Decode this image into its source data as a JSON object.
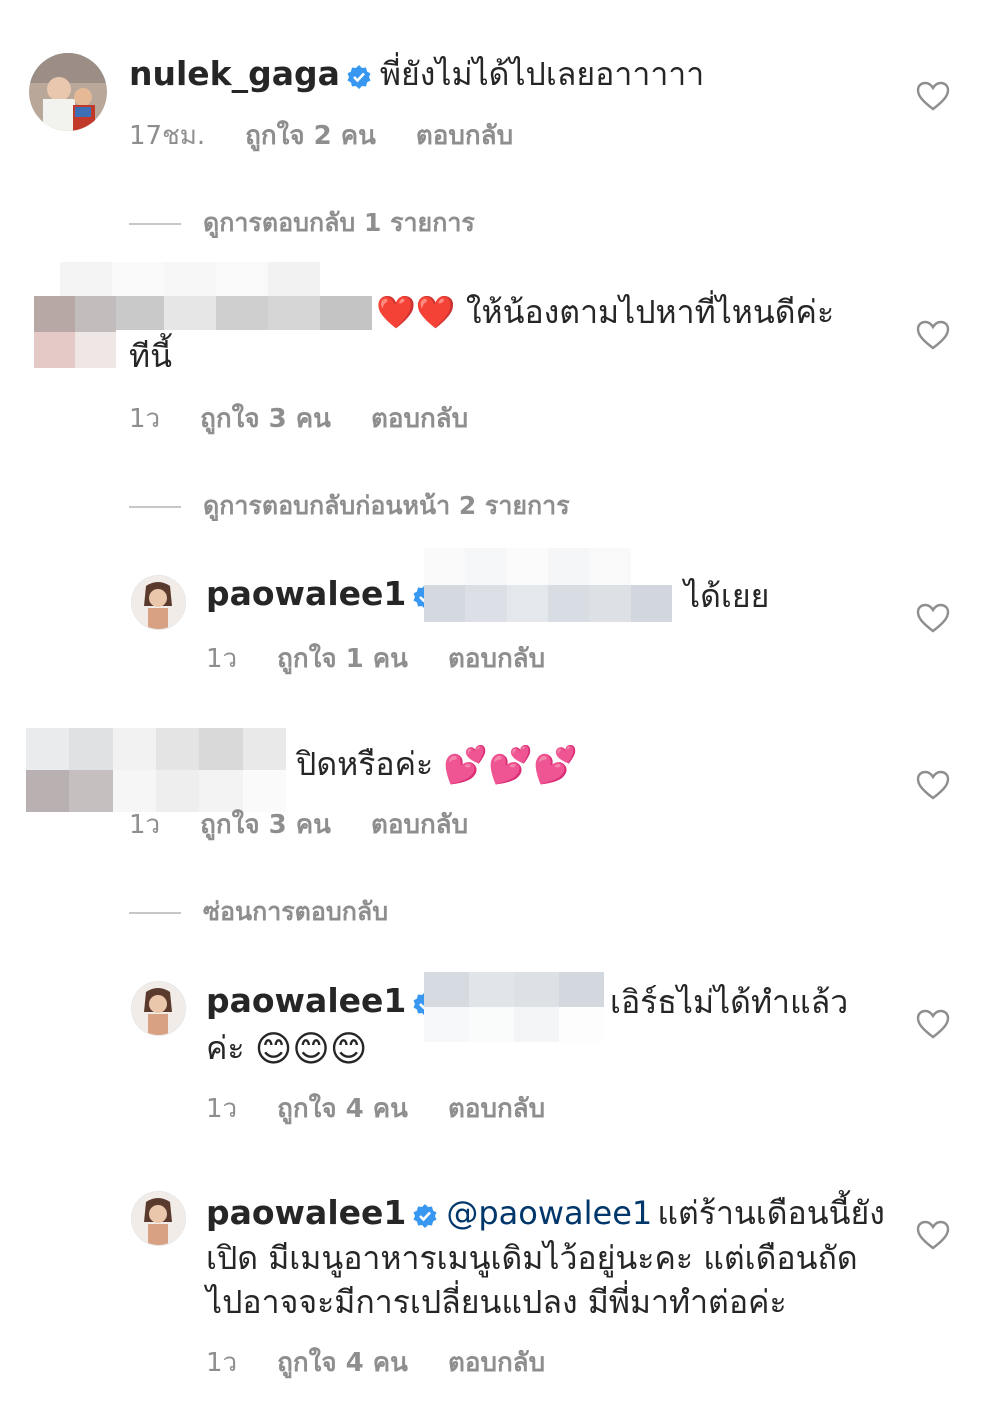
{
  "comments": [
    {
      "username": "nulek_gaga",
      "text": "พี่ยังไม่ได้ไปเลยอาาาาา",
      "time": "17ชม.",
      "likes": "ถูกใจ 2 คน",
      "reply": "ตอบกลับ"
    },
    {
      "text": "❤️❤️ ให้น้องตามไปหาที่ไหนดีค่ะ",
      "text2": "ทีนี้",
      "time": "1ว",
      "likes": "ถูกใจ 3 คน",
      "reply": "ตอบกลับ"
    },
    {
      "username": "paowalee1",
      "text": "ได้เยย",
      "time": "1ว",
      "likes": "ถูกใจ 1 คน",
      "reply": "ตอบกลับ"
    },
    {
      "text": "ปิดหรือค่ะ",
      "emojis": "💕💕💕",
      "time": "1ว",
      "likes": "ถูกใจ 3 คน",
      "reply": "ตอบกลับ"
    },
    {
      "username": "paowalee1",
      "text": "เอิร์ธไม่ได้ทำแล้ว",
      "text2": "ค่ะ",
      "emojis": "😊😊😊",
      "time": "1ว",
      "likes": "ถูกใจ 4 คน",
      "reply": "ตอบกลับ"
    },
    {
      "username": "paowalee1",
      "mention": "@paowalee1",
      "text": "แต่ร้านเดือนนี้ยัง",
      "text2": "เปิด มีเมนูอาหารเมนูเดิมไว้อยู่นะคะ แต่เดือนถัด",
      "text3": "ไปอาจจะมีการเปลี่ยนแปลง มีพี่มาทำต่อค่ะ",
      "time": "1ว",
      "likes": "ถูกใจ 4 คน",
      "reply": "ตอบกลับ"
    }
  ],
  "toggles": {
    "view_replies": "ดูการตอบกลับ 1 รายการ",
    "view_previous": "ดูการตอบกลับก่อนหน้า 2 รายการ",
    "hide_replies": "ซ่อนการตอบกลับ"
  },
  "colors": {
    "text": "#262626",
    "meta": "#8e8e8e",
    "mention": "#00376b",
    "verified": "#3897f0"
  }
}
